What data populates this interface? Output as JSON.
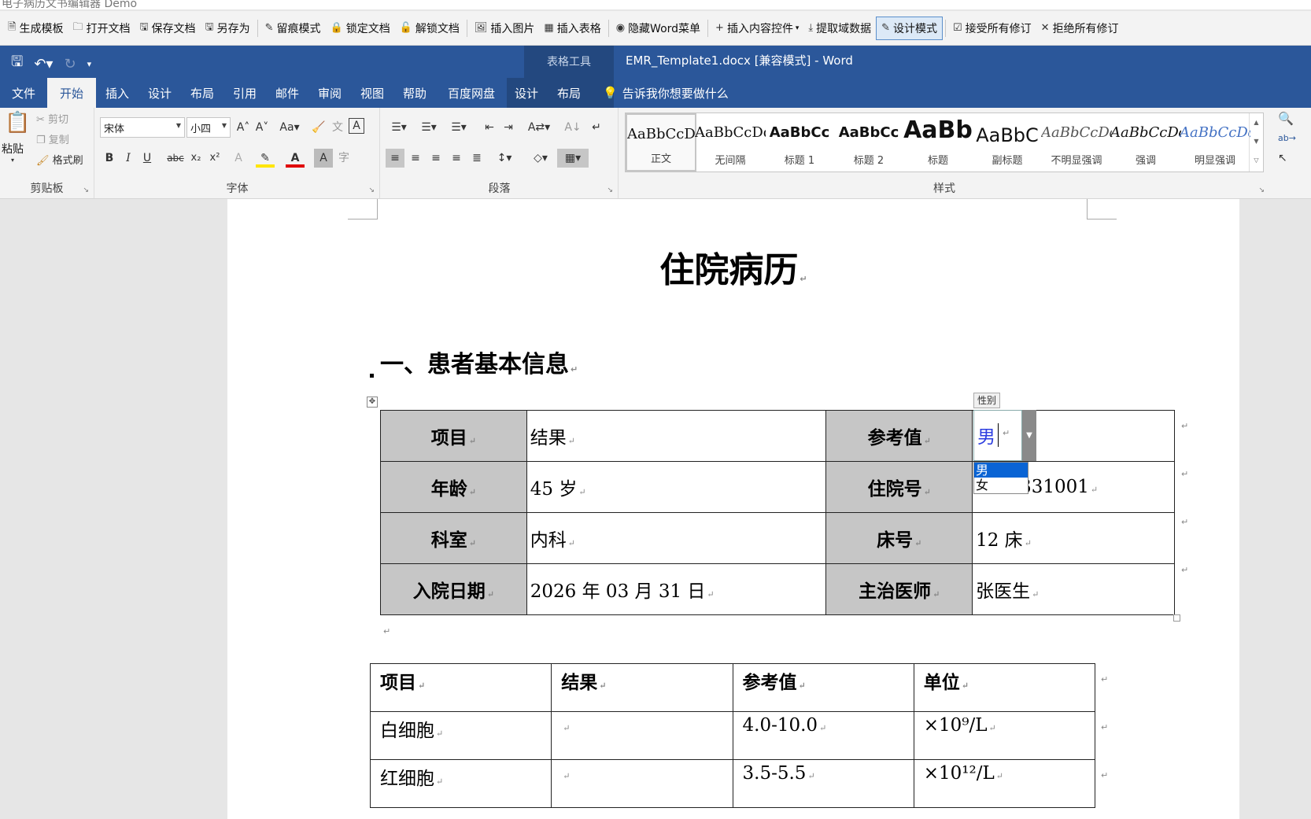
{
  "window": {
    "title": "电子病历文书编辑器 Demo"
  },
  "toolbar": {
    "items": [
      {
        "icon": "document-icon",
        "label": "生成模板"
      },
      {
        "icon": "folder-icon",
        "label": "打开文档"
      },
      {
        "icon": "save-doc-icon",
        "label": "保存文档"
      },
      {
        "icon": "save-as-icon",
        "label": "另存为"
      },
      {
        "icon": "pen-icon",
        "label": "留痕模式"
      },
      {
        "icon": "lock-icon",
        "label": "锁定文档"
      },
      {
        "icon": "unlock-icon",
        "label": "解锁文档"
      },
      {
        "icon": "image-icon",
        "label": "插入图片"
      },
      {
        "icon": "table-icon",
        "label": "插入表格"
      },
      {
        "icon": "eye-icon",
        "label": "隐藏Word菜单"
      },
      {
        "icon": "plus-icon",
        "label": "插入内容控件"
      },
      {
        "icon": "extract-icon",
        "label": "提取域数据"
      },
      {
        "icon": "design-pen-icon",
        "label": "设计模式"
      },
      {
        "icon": "checkbox-icon",
        "label": "接受所有修订"
      },
      {
        "icon": "x-icon",
        "label": "拒绝所有修订"
      }
    ]
  },
  "word": {
    "doc_title": "EMR_Template1.docx [兼容模式]  -  Word",
    "context_tab_group": "表格工具",
    "tabs": [
      "文件",
      "开始",
      "插入",
      "设计",
      "布局",
      "引用",
      "邮件",
      "审阅",
      "视图",
      "帮助",
      "百度网盘",
      "设计",
      "布局"
    ],
    "active_tab": "开始",
    "tell_me": "告诉我你想要做什么"
  },
  "ribbon": {
    "clipboard": {
      "group": "剪贴板",
      "paste": "粘贴",
      "cut": "剪切",
      "copy": "复制",
      "format_painter": "格式刷"
    },
    "font": {
      "group": "字体",
      "family": "宋体",
      "size": "小四"
    },
    "paragraph": {
      "group": "段落"
    },
    "styles": {
      "group": "样式",
      "items": [
        {
          "preview": "AaBbCcDd",
          "name": "正文"
        },
        {
          "preview": "AaBbCcDd",
          "name": "无间隔"
        },
        {
          "preview": "AaBbCc",
          "name": "标题 1"
        },
        {
          "preview": "AaBbCc",
          "name": "标题 2"
        },
        {
          "preview": "AaBb",
          "name": "标题"
        },
        {
          "preview": "AaBbC",
          "name": "副标题"
        },
        {
          "preview": "AaBbCcDd",
          "name": "不明显强调"
        },
        {
          "preview": "AaBbCcDd",
          "name": "强调"
        },
        {
          "preview": "AaBbCcDd",
          "name": "明显强调"
        }
      ]
    }
  },
  "document": {
    "title": "住院病历",
    "section1": "一、患者基本信息",
    "table1": [
      {
        "l1": "项目",
        "v1": "结果",
        "l2": "参考值",
        "v2": ""
      },
      {
        "l1": "年龄",
        "v1": "45 岁",
        "l2": "住院号",
        "v2": "331001"
      },
      {
        "l1": "科室",
        "v1": "内科",
        "l2": "床号",
        "v2": "12 床"
      },
      {
        "l1": "入院日期",
        "v1": "2026 年 03 月 31 日",
        "l2": "主治医师",
        "v2": "张医生"
      }
    ],
    "content_control": {
      "tag": "性别",
      "value": "男",
      "options": [
        "男",
        "女"
      ],
      "selected": "男"
    },
    "table2": {
      "headers": [
        "项目",
        "结果",
        "参考值",
        "单位"
      ],
      "rows": [
        [
          "白细胞",
          "",
          "4.0-10.0",
          "×10⁹/L"
        ],
        [
          "红细胞",
          "",
          "3.5-5.5",
          "×10¹²/L"
        ]
      ]
    }
  }
}
